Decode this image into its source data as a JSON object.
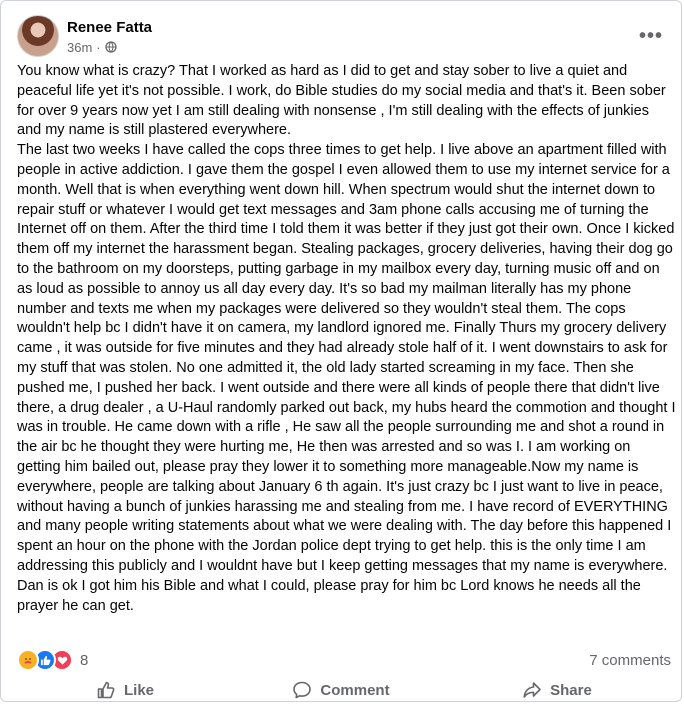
{
  "post": {
    "author": "Renee Fatta",
    "time": "36m",
    "separator": "·",
    "paragraphs": [
      "You know what is crazy?  That I worked as hard as I did to get and stay sober to live a quiet and peaceful life yet it's not possible.  I work, do Bible studies do my social media and that's it.  Been sober for over 9 years now yet I am still dealing with nonsense , I'm still dealing with the effects of junkies and my name is still plastered everywhere.",
      "The last two weeks I have called the cops three times to get help.  I live above an apartment filled with people in active addiction.  I gave them the gospel I even allowed them to use my internet service for a month.  Well that is when everything went down hill.  When spectrum would shut the internet down to repair stuff or whatever I would get text messages and 3am phone calls accusing me of turning the Internet off on them. After the third time I told them it was better if they just got their own.  Once I kicked them off my internet the harassment began. Stealing packages, grocery deliveries, having their dog go to the bathroom on my doorsteps, putting garbage in my mailbox every day, turning music off and on as loud as possible to annoy us all day every day.  It's so bad my mailman literally has my phone number and texts me when my packages were delivered so they wouldn't steal them. The cops wouldn't help bc I didn't have it on camera, my landlord ignored me.  Finally Thurs my grocery delivery came , it was outside for five minutes and they had already stole half of it.  I went downstairs to ask for my stuff that was stolen.  No one admitted it, the old lady started screaming in my face. Then she pushed me, I pushed her back. I went outside and there were all kinds of people there that didn't live there, a drug dealer , a U-Haul randomly parked out back, my hubs heard the commotion and thought I was in trouble. He came down with a rifle , He saw all the people surrounding me and shot a round in the air bc he thought they were hurting me,  He then was arrested and so was I. I am working on getting him bailed out, please pray they lower it to something more manageable.Now my name is everywhere, people are talking about January 6 th again.  It's just crazy bc I just want to live in peace, without having a bunch of junkies harassing me and stealing from me.  I have record of EVERYTHING and many people writing statements about what we were dealing with.  The day before this happened I spent an hour on the phone with the Jordan police dept trying to get help.  this is the only time I am addressing this publicly and I wouldnt have but I keep getting messages that my name is everywhere.   Dan is ok I got him his Bible and what I could, please pray for him bc Lord knows he needs all the prayer he can get."
    ]
  },
  "stats": {
    "reaction_count": "8",
    "comments": "7 comments",
    "reactions": [
      "care",
      "like",
      "love"
    ]
  },
  "actions": {
    "like": "Like",
    "comment": "Comment",
    "share": "Share"
  },
  "icons": {
    "more": "more-options-icon",
    "globe": "globe-icon",
    "like": "thumbs-up-icon",
    "comment": "comment-bubble-icon",
    "share": "share-arrow-icon"
  },
  "colors": {
    "like_blue": "#1877f2",
    "love_red": "#f33e58",
    "care_yellow": "#f7b125",
    "secondary_text": "#65676b"
  }
}
